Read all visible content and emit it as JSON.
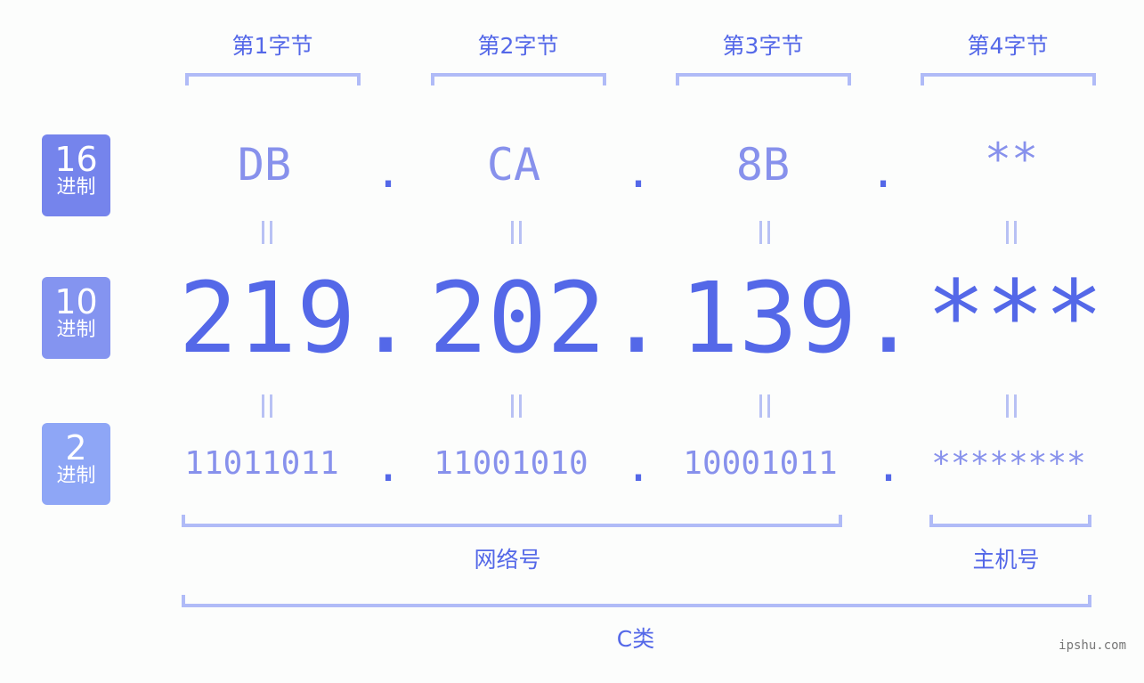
{
  "bytes": [
    {
      "label": "第1字节",
      "hex": "DB",
      "dec": "219",
      "bin": "11011011"
    },
    {
      "label": "第2字节",
      "hex": "CA",
      "dec": "202",
      "bin": "11001010"
    },
    {
      "label": "第3字节",
      "hex": "8B",
      "dec": "139",
      "bin": "10001011"
    },
    {
      "label": "第4字节",
      "hex": "**",
      "dec": "***",
      "bin": "********"
    }
  ],
  "separator": ".",
  "bases": [
    {
      "num": "16",
      "unit": "进制",
      "color": "#7584ec"
    },
    {
      "num": "10",
      "unit": "进制",
      "color": "#8494f0"
    },
    {
      "num": "2",
      "unit": "进制",
      "color": "#8ea6f6"
    }
  ],
  "network_label": "网络号",
  "host_label": "主机号",
  "class_label": "C类",
  "watermark": "ipshu.com",
  "colors": {
    "primary": "#5468e8",
    "light": "#8791ec",
    "bracket": "#b0bbf7"
  }
}
